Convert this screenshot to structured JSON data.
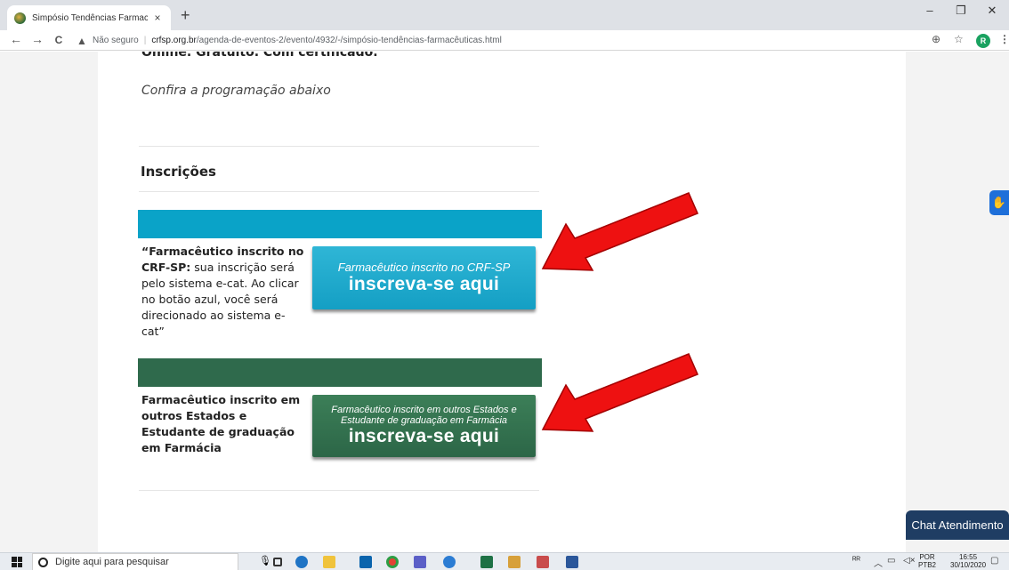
{
  "browser": {
    "tab_title": "Simpósio Tendências Farmacêutic",
    "tab_close": "×",
    "new_tab": "+",
    "window_controls": [
      "–",
      "❐",
      "✕"
    ],
    "nav": {
      "back": "←",
      "forward": "→",
      "reload": "C"
    },
    "security_label": "Não seguro",
    "separator": "|",
    "url_host": "crfsp.org.br",
    "url_path": "/agenda-de-eventos-2/evento/4932/-/simpósio-tendências-farmacêuticas.html",
    "profile_initial": "R",
    "icons": [
      "zoom-icon",
      "star-icon",
      "menu-icon"
    ]
  },
  "page": {
    "cut_text": "Online. Gratuito. Com certificado.",
    "confira": "Confira a programação abaixo",
    "inscricoes_title": "Inscrições",
    "block1": {
      "bold": "“Farmacêutico inscrito no CRF-SP:",
      "text": " sua inscrição será pelo sistema e-cat. Ao clicar no botão azul, você será direcionado ao sistema e-cat”",
      "button_small": "Farmacêutico inscrito no CRF-SP",
      "button_big": "inscreva-se aqui",
      "band_color": "#0aa3c8"
    },
    "block2": {
      "bold": "Farmacêutico inscrito em outros Estados e Estudante de graduação em Farmácia",
      "button_small": "Farmacêutico inscrito em outros Estados e Estudante de graduação em Farmácia",
      "button_big": "inscreva-se aqui",
      "band_color": "#2f6a4c"
    },
    "chat_label": "Chat Atendimento",
    "arrow_color": "#ee1111"
  },
  "taskbar": {
    "search_placeholder": "Digite aqui para pesquisar",
    "lang": "POR",
    "lang_sub": "PTB2",
    "time": "16:55",
    "date": "30/10/2020",
    "tray_icons": [
      "people-icon",
      "chevron-up-icon",
      "network-icon",
      "speaker-icon",
      "notification-icon"
    ]
  }
}
